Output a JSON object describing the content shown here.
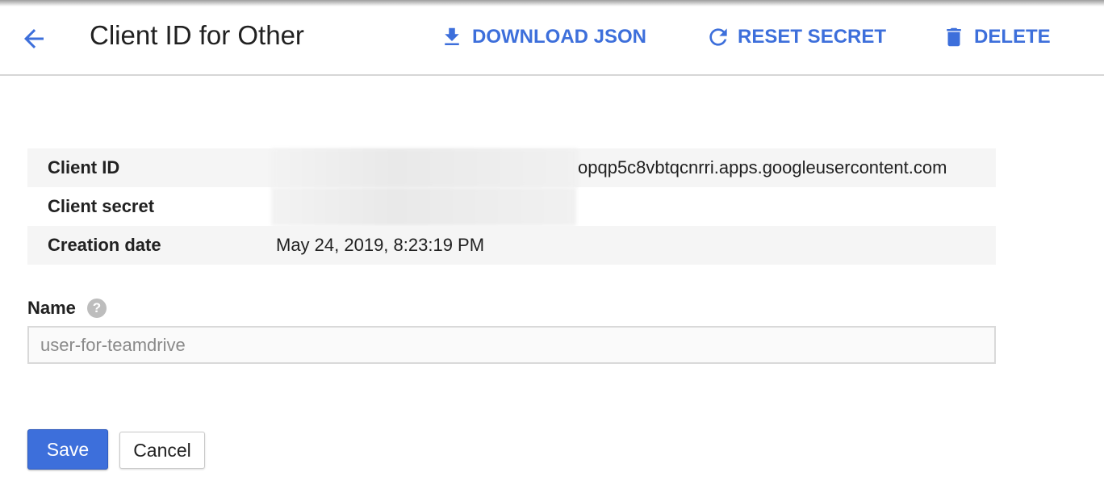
{
  "colors": {
    "accent": "#3d6fdb",
    "header_border": "#d6d6d6",
    "row_shade": "#f5f5f5"
  },
  "header": {
    "back_icon": "arrow-back-icon",
    "title": "Client ID for Other",
    "actions": [
      {
        "icon": "download-icon",
        "label": "DOWNLOAD JSON"
      },
      {
        "icon": "refresh-icon",
        "label": "RESET SECRET"
      },
      {
        "icon": "trash-icon",
        "label": "DELETE"
      }
    ]
  },
  "details": {
    "rows": [
      {
        "label": "Client ID",
        "value": "opqp5c8vbtqcnrri.apps.googleusercontent.com"
      },
      {
        "label": "Client secret",
        "value": ""
      },
      {
        "label": "Creation date",
        "value": "May 24, 2019, 8:23:19 PM"
      }
    ]
  },
  "form": {
    "name_label": "Name",
    "help_icon": "help-icon",
    "help_glyph": "?",
    "name_value": "user-for-teamdrive"
  },
  "buttons": {
    "save": "Save",
    "cancel": "Cancel"
  }
}
